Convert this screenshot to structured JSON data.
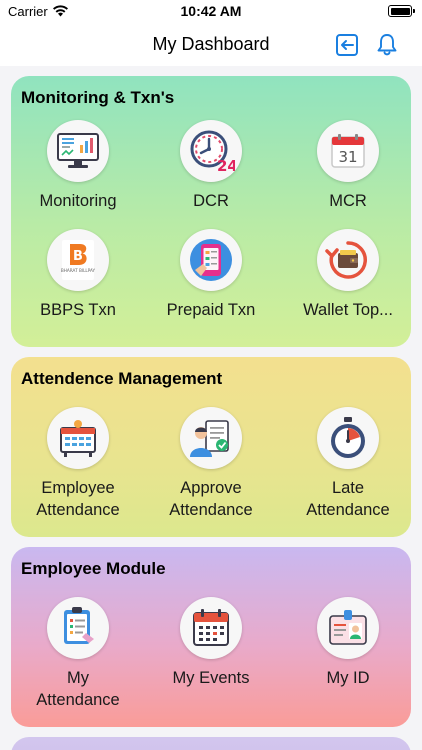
{
  "status_bar": {
    "carrier": "Carrier",
    "time": "10:42 AM"
  },
  "nav": {
    "title": "My Dashboard",
    "logout_icon": "logout-icon",
    "bell_icon": "bell-icon"
  },
  "sections": {
    "monitoring": {
      "title": "Monitoring & Txn's",
      "items": [
        {
          "label": "Monitoring"
        },
        {
          "label": "DCR",
          "badge": "24"
        },
        {
          "label": "MCR",
          "badge": "31"
        },
        {
          "label": "BBPS Txn",
          "logo_text": "BHARAT BILLPAY",
          "logo_letter": "B"
        },
        {
          "label": "Prepaid Txn"
        },
        {
          "label": "Wallet Top..."
        }
      ]
    },
    "attendance": {
      "title": "Attendence Management",
      "items": [
        {
          "label_line1": "Employee",
          "label_line2": "Attendance"
        },
        {
          "label_line1": "Approve",
          "label_line2": "Attendance"
        },
        {
          "label_line1": "Late",
          "label_line2": "Attendance"
        }
      ]
    },
    "employee": {
      "title": "Employee Module",
      "items": [
        {
          "label_line1": "My",
          "label_line2": "Attendance"
        },
        {
          "label_line1": "My Events",
          "label_line2": ""
        },
        {
          "label_line1": "My ID",
          "label_line2": ""
        }
      ]
    }
  },
  "colors": {
    "accent": "#1a7fe0",
    "card1": "#a6e8b4",
    "card2": "#ece38f",
    "card3": "#f2a6b6"
  }
}
